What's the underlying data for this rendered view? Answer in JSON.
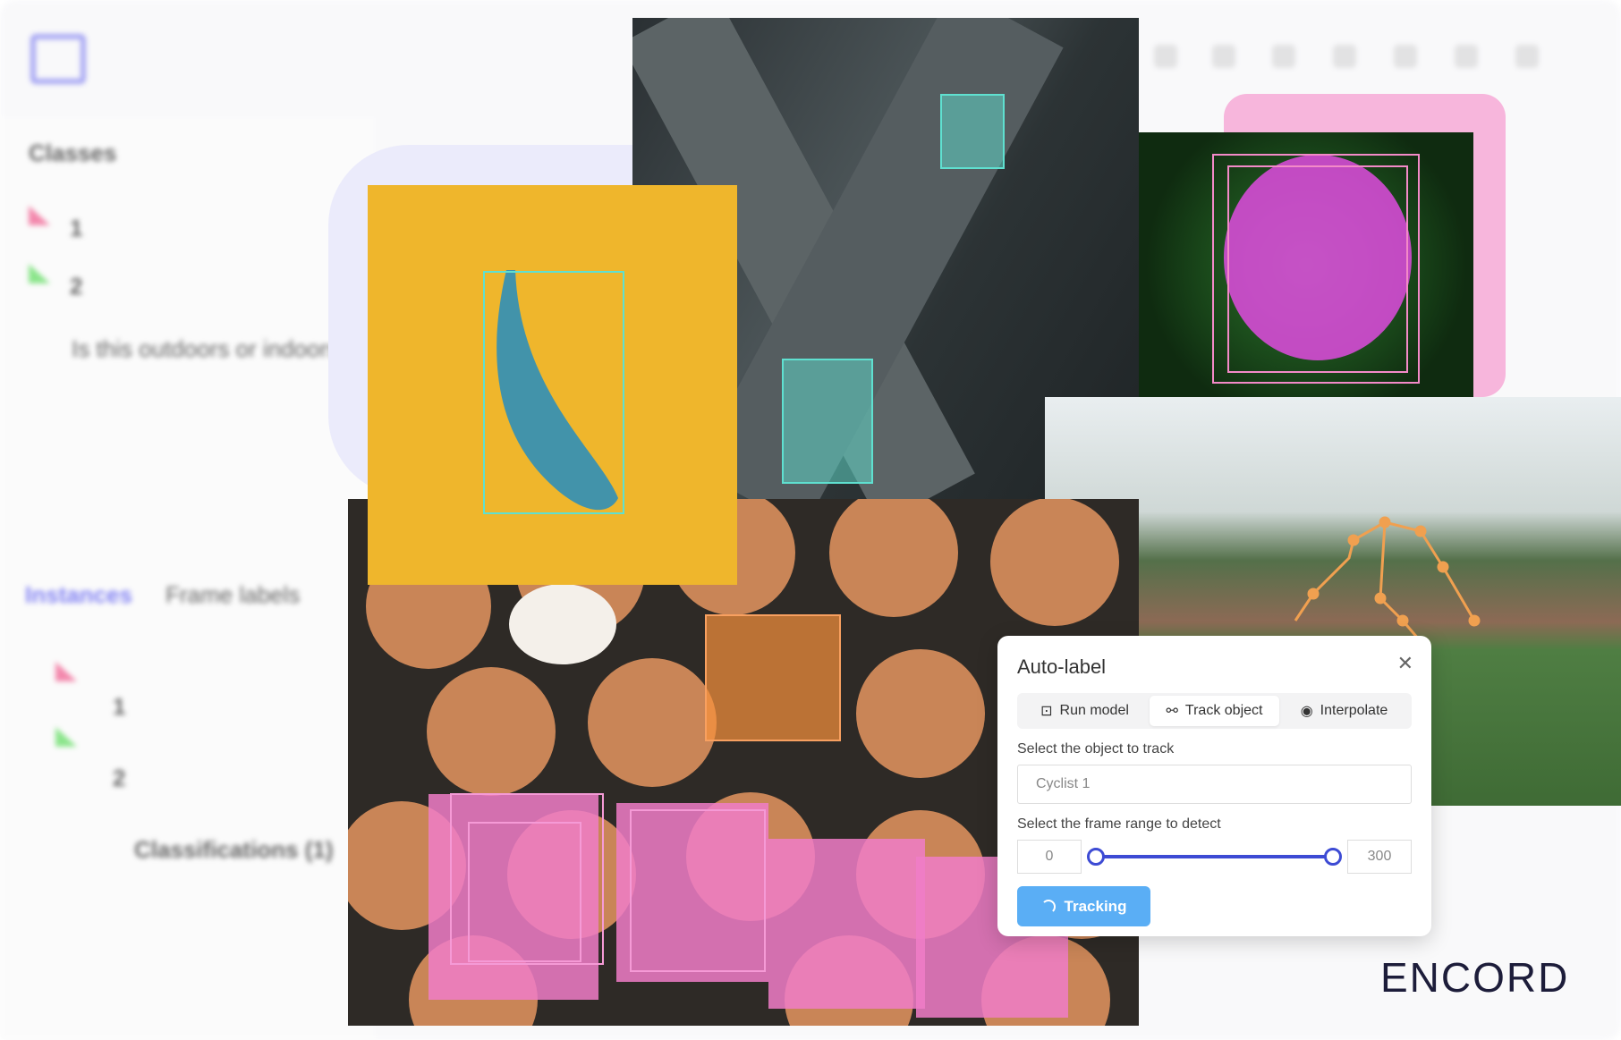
{
  "sidebar": {
    "classes_title": "Classes",
    "classes": [
      {
        "label": "1",
        "color": "#f06292"
      },
      {
        "label": "2",
        "color": "#66dd66"
      }
    ],
    "question": "Is this outdoors or indoors",
    "tabs": [
      {
        "label": "Instances"
      },
      {
        "label": "Frame labels"
      }
    ],
    "instances": [
      {
        "label": "1",
        "color": "#f06292"
      },
      {
        "label": "2",
        "color": "#66dd66"
      }
    ],
    "classifications": "Classifications (1)"
  },
  "auto_label": {
    "title": "Auto-label",
    "close_icon": "close-icon",
    "tabs": [
      {
        "label": "Run model",
        "icon": "robot-icon"
      },
      {
        "label": "Track object",
        "icon": "track-icon",
        "active": true
      },
      {
        "label": "Interpolate",
        "icon": "map-pin-icon"
      }
    ],
    "object_label": "Select the object to track",
    "object_value": "Cyclist 1",
    "range_label": "Select the frame range to detect",
    "range_min": "0",
    "range_max": "300",
    "tracking_button": "Tracking"
  },
  "brand": {
    "logo": "ENCORD",
    "accent": "#3d4bd4"
  }
}
